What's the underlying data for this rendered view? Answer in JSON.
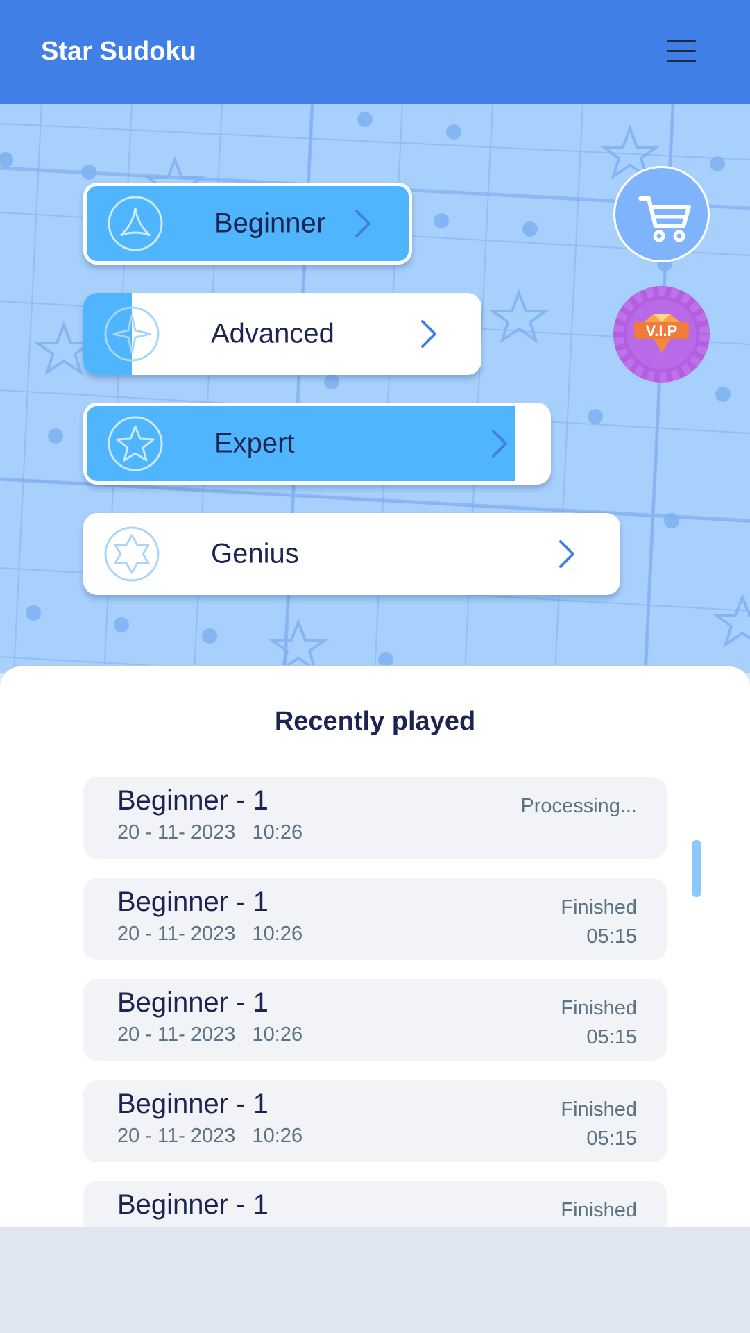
{
  "header": {
    "title": "Star Sudoku",
    "menu_icon": "hamburger-menu-icon"
  },
  "levels": [
    {
      "label": "Beginner",
      "icon": "triangle-star-icon",
      "progress": 1.0
    },
    {
      "label": "Advanced",
      "icon": "four-point-star-icon",
      "progress": 0.12
    },
    {
      "label": "Expert",
      "icon": "five-point-star-icon",
      "progress": 0.92
    },
    {
      "label": "Genius",
      "icon": "six-point-star-icon",
      "progress": 0.0
    }
  ],
  "shop": {
    "cart_icon": "shopping-cart-icon",
    "vip_label": "V.I.P"
  },
  "recent": {
    "title": "Recently played",
    "items": [
      {
        "name": "Beginner - 1",
        "date": "20 - 11- 2023",
        "time": "10:26",
        "status": "Processing...",
        "duration": ""
      },
      {
        "name": "Beginner - 1",
        "date": "20 - 11- 2023",
        "time": "10:26",
        "status": "Finished",
        "duration": "05:15"
      },
      {
        "name": "Beginner - 1",
        "date": "20 - 11- 2023",
        "time": "10:26",
        "status": "Finished",
        "duration": "05:15"
      },
      {
        "name": "Beginner - 1",
        "date": "20 - 11- 2023",
        "time": "10:26",
        "status": "Finished",
        "duration": "05:15"
      },
      {
        "name": "Beginner - 1",
        "date": "",
        "time": "",
        "status": "Finished",
        "duration": ""
      }
    ]
  },
  "colors": {
    "header": "#4080e6",
    "accent_fill": "#4fb5fc",
    "background": "#a8d0fc",
    "text_dark": "#1e2452",
    "text_muted": "#5d7283"
  }
}
